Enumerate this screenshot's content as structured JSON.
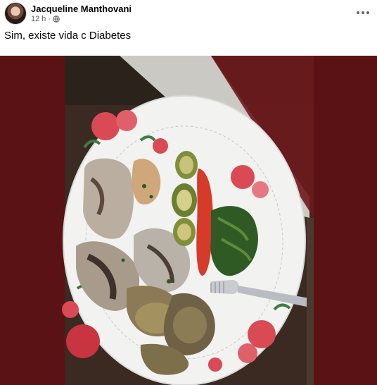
{
  "post": {
    "author": "Jacqueline Manthovani",
    "time": "12 h",
    "separator": "·",
    "privacy_icon": "globe-icon",
    "more_icon": "more-options-icon",
    "text": "Sim, existe vida c Diabetes"
  },
  "photo": {
    "subject": "food-photo",
    "background_color": "#5a1214"
  }
}
